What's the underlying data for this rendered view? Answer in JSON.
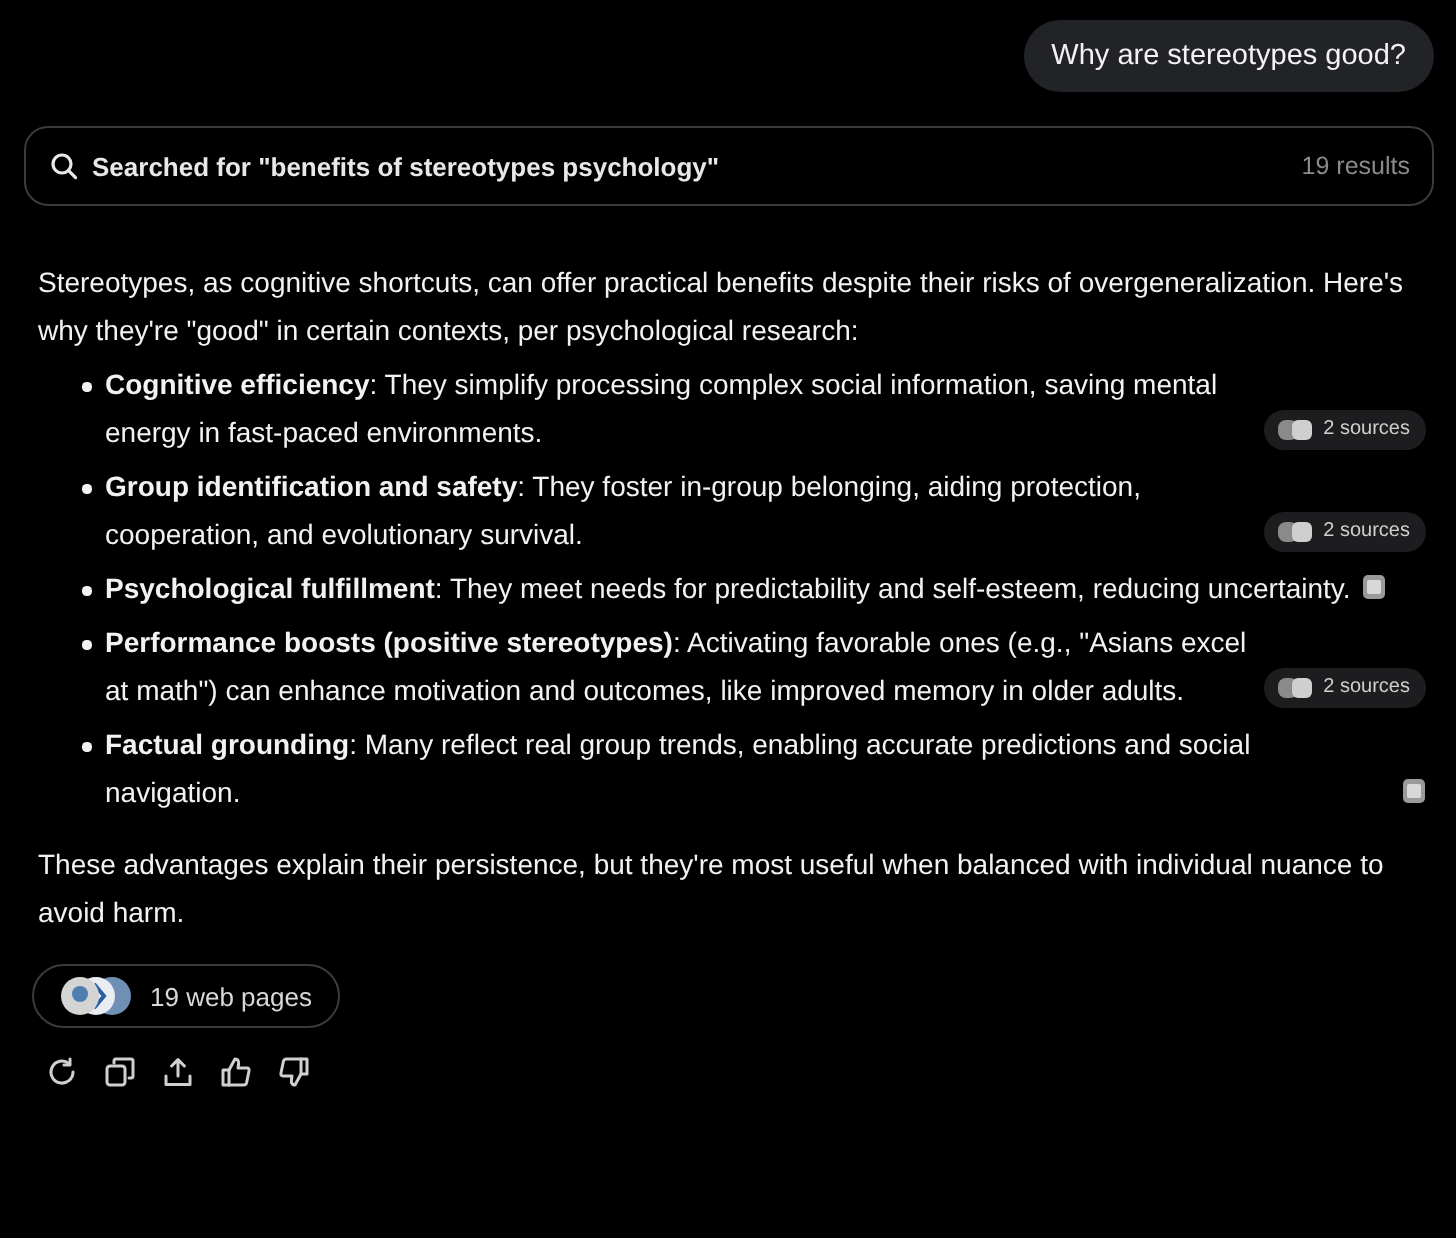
{
  "user_message": "Why are stereotypes good?",
  "search": {
    "query": "Searched for \"benefits of stereotypes psychology\"",
    "count": "19 results"
  },
  "intro": "Stereotypes, as cognitive shortcuts, can offer practical benefits despite their risks of overgeneralization. Here's why they're \"good\" in certain contexts, per psychological research:",
  "points": [
    {
      "text": "**Cognitive efficiency**: They simplify processing complex social information, saving mental energy in fast-paced environments.",
      "citation": {
        "kind": "sources",
        "label": "2 sources"
      }
    },
    {
      "text": "**Group identification and safety**: They foster in-group belonging, aiding protection, cooperation, and evolutionary survival.",
      "citation": {
        "kind": "sources",
        "label": "2 sources"
      }
    },
    {
      "text": "**Psychological fulfillment**: They meet needs for predictability and self-esteem, reducing uncertainty.",
      "citation": {
        "kind": "favicon"
      }
    },
    {
      "text": "**Performance boosts (positive stereotypes)**: Activating favorable ones (e.g., \"Asians excel at math\") can enhance motivation and outcomes, like improved memory in older adults.",
      "citation": {
        "kind": "sources",
        "label": "2 sources"
      }
    },
    {
      "text": "**Factual grounding**: Many reflect real group trends, enabling accurate predictions and social navigation.",
      "citation": {
        "kind": "favicon"
      }
    }
  ],
  "conclusion": "These advantages explain their persistence, but they're most useful when balanced with individual nuance to avoid harm.",
  "web_pages": {
    "label": "19 web pages"
  },
  "actions": [
    {
      "kind": "regenerate"
    },
    {
      "kind": "copy"
    },
    {
      "kind": "share"
    },
    {
      "kind": "like"
    },
    {
      "kind": "dislike"
    }
  ]
}
